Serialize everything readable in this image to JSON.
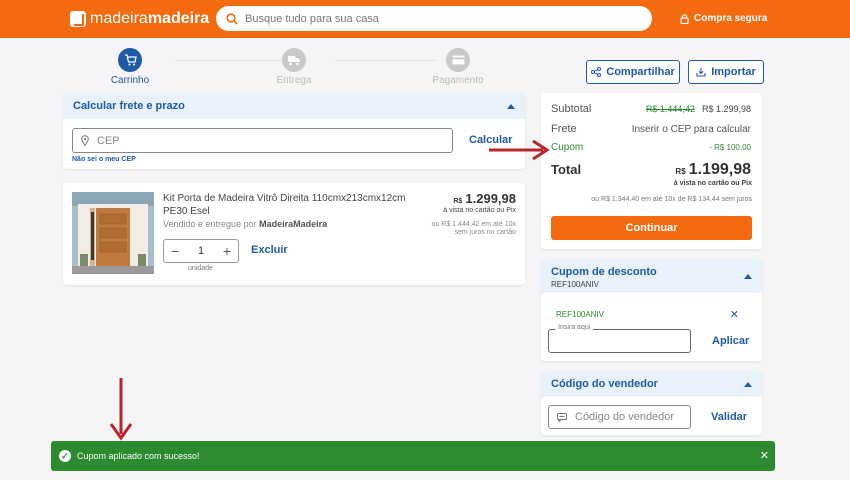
{
  "header": {
    "logo_a": "madeira",
    "logo_b": "madeira",
    "search_placeholder": "Busque tudo para sua casa",
    "secure_label": "Compra segura"
  },
  "steps": [
    {
      "label": "Carrinho",
      "icon": "cart-icon",
      "active": true
    },
    {
      "label": "Entrega",
      "icon": "truck-icon",
      "active": false
    },
    {
      "label": "Pagamento",
      "icon": "card-icon",
      "active": false
    }
  ],
  "actions": {
    "share": "Compartilhar",
    "import": "Importar"
  },
  "shipping": {
    "title": "Calcular frete e prazo",
    "cep_placeholder": "CEP",
    "calc_label": "Calcular",
    "unknown_cep": "Não sei o meu CEP"
  },
  "product": {
    "name": "Kit Porta de Madeira Vitrô Direita 110cmx213cmx12cm PE30 Esel",
    "seller_prefix": "Vendido e entregue por",
    "seller": "MadeiraMadeira",
    "currency": "R$",
    "price": "1.299,98",
    "price_note": "à vista no cartão ou Pix",
    "installments_line1": "ou R$ 1.444,42 em até 10x",
    "installments_line2": "sem juros no cartão",
    "quantity": "1",
    "unit_label": "unidade",
    "delete_label": "Excluir"
  },
  "summary": {
    "subtotal_label": "Subtotal",
    "subtotal_old": "R$ 1.444,42",
    "subtotal_new": "R$ 1.299,98",
    "frete_label": "Frete",
    "frete_value": "Inserir o CEP para calcular",
    "cupom_label": "Cupom",
    "cupom_value": "- R$ 100,00",
    "total_label": "Total",
    "total_currency": "R$",
    "total_value": "1.199,98",
    "total_note": "à vista no cartão ou Pix",
    "total_installments": "ou R$ 1.344,40 em até 10x de R$ 134,44 sem juros",
    "continue_label": "Continuar"
  },
  "coupon": {
    "title": "Cupom de desconto",
    "code": "REF100ANIV",
    "applied_code": "REF100ANIV",
    "input_label": "Insira aqui",
    "apply_label": "Aplicar"
  },
  "seller_code": {
    "title": "Código do vendedor",
    "placeholder": "Código do vendedor",
    "validate_label": "Validar"
  },
  "toast": {
    "message": "Cupom aplicado com sucesso!"
  },
  "colors": {
    "brand": "#f36a0f",
    "primary": "#1e5aa8",
    "success": "#2c8a2f",
    "annotation": "#b5262b"
  }
}
